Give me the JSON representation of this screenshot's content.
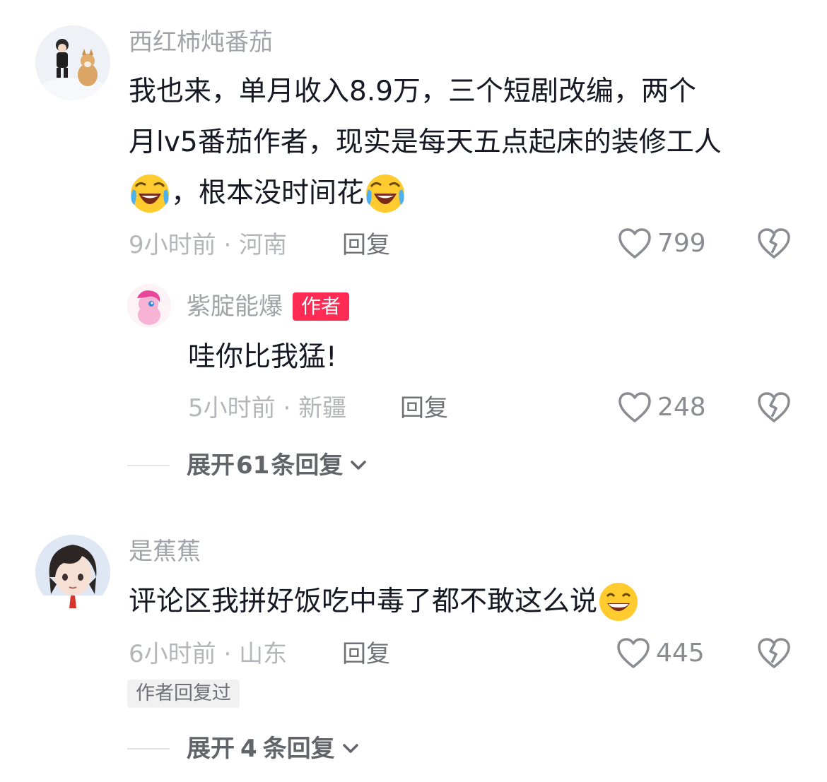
{
  "comments": [
    {
      "username": "西红柿炖番茄",
      "text_line1": "我也来，单月收入8.9万，三个短剧改编，两个",
      "text_line2": "月lv5番茄作者，现实是每天五点起床的装修工人",
      "text_line3": "，根本没时间花",
      "emoji_1": "laughing-crying-emoji",
      "emoji_2": "laughing-crying-emoji",
      "time": "9小时前",
      "location": "河南",
      "meta_sep": " · ",
      "reply_label": "回复",
      "likes": "799"
    },
    {
      "username": "是蕉蕉",
      "text": "评论区我拼好饭吃中毒了都不敢这么说",
      "emoji": "grinning-emoji",
      "time": "6小时前",
      "location": "山东",
      "meta_sep": " · ",
      "reply_label": "回复",
      "likes": "445",
      "author_replied_tag": "作者回复过"
    }
  ],
  "reply": {
    "username": "紫腚能爆",
    "badge": "作者",
    "text": "哇你比我猛!",
    "time": "5小时前",
    "location": "新疆",
    "meta_sep": " · ",
    "reply_label": "回复",
    "likes": "248"
  },
  "expand_1": {
    "prefix": "展开",
    "count": "61",
    "suffix": "条回复"
  },
  "expand_2": {
    "prefix": "展开",
    "count": "4",
    "suffix": "条回复"
  },
  "colors": {
    "accent": "#fe2c55",
    "username": "#a1a3a8",
    "text": "#161823"
  }
}
